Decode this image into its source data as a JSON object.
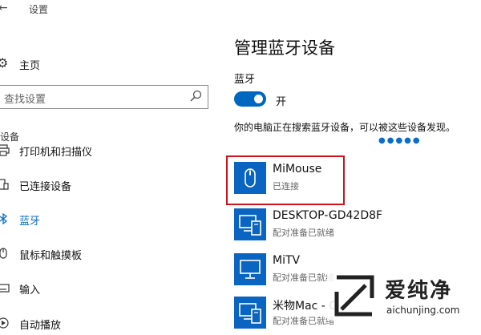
{
  "window": {
    "back_glyph": "←",
    "title": "设置"
  },
  "sidebar": {
    "home": "主页",
    "search_placeholder": "查找设置",
    "section": "设备",
    "items": [
      {
        "label": "打印机和扫描仪",
        "icon": "printer-icon",
        "active": false
      },
      {
        "label": "已连接设备",
        "icon": "connected-devices-icon",
        "active": false
      },
      {
        "label": "蓝牙",
        "icon": "bluetooth-icon",
        "active": true
      },
      {
        "label": "鼠标和触摸板",
        "icon": "mouse-icon",
        "active": false
      },
      {
        "label": "输入",
        "icon": "keyboard-icon",
        "active": false
      },
      {
        "label": "自动播放",
        "icon": "autoplay-icon",
        "active": false
      }
    ]
  },
  "main": {
    "title": "管理蓝牙设备",
    "bluetooth_label": "蓝牙",
    "toggle_state": "开",
    "scan_message": "你的电脑正在搜索蓝牙设备，可以被这些设备发现。",
    "devices": [
      {
        "name": "MiMouse",
        "status": "已连接",
        "icon": "mouse-icon"
      },
      {
        "name": "DESKTOP-GD42D8F",
        "status": "配对准备已就绪",
        "icon": "computer-icon"
      },
      {
        "name": "MiTV",
        "status": "配对准备已就绪",
        "icon": "monitor-icon"
      },
      {
        "name": "米物Mac - C",
        "status": "配对准备已就绪",
        "icon": "computer-icon"
      }
    ]
  },
  "watermark": {
    "title": "爱纯净",
    "url": "aichunjing.com"
  },
  "colors": {
    "accent": "#0067c0",
    "tile": "#0a64c1",
    "highlight": "#d0121b"
  }
}
